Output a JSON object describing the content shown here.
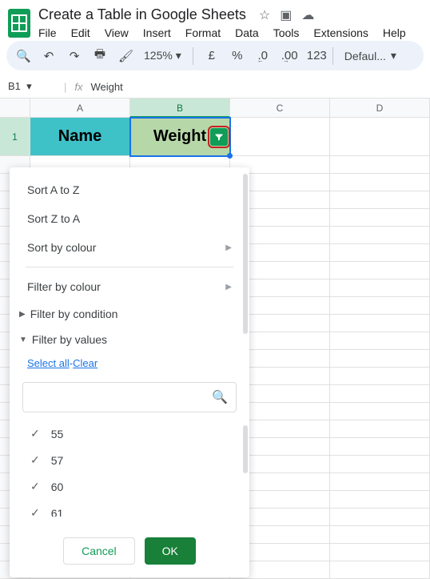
{
  "doc": {
    "title": "Create a Table in Google Sheets"
  },
  "menus": [
    "File",
    "Edit",
    "View",
    "Insert",
    "Format",
    "Data",
    "Tools",
    "Extensions",
    "Help"
  ],
  "toolbar": {
    "zoom": "125%",
    "font": "Defaul...",
    "currency": "£",
    "percent": "%",
    "dec_dec": ".0",
    "dec_inc": ".00",
    "num": "123"
  },
  "namebox": {
    "ref": "B1",
    "formula": "Weight"
  },
  "columns": [
    "A",
    "B",
    "C",
    "D"
  ],
  "row1_num": "1",
  "headers": {
    "a": "Name",
    "b": "Weight"
  },
  "filter_menu": {
    "sort_az": "Sort A to Z",
    "sort_za": "Sort Z to A",
    "sort_colour": "Sort by colour",
    "filter_colour": "Filter by colour",
    "filter_condition": "Filter by condition",
    "filter_values": "Filter by values",
    "select_all": "Select all",
    "clear": "Clear",
    "search_placeholder": "",
    "values": [
      "55",
      "57",
      "60",
      "61"
    ],
    "cancel": "Cancel",
    "ok": "OK"
  }
}
